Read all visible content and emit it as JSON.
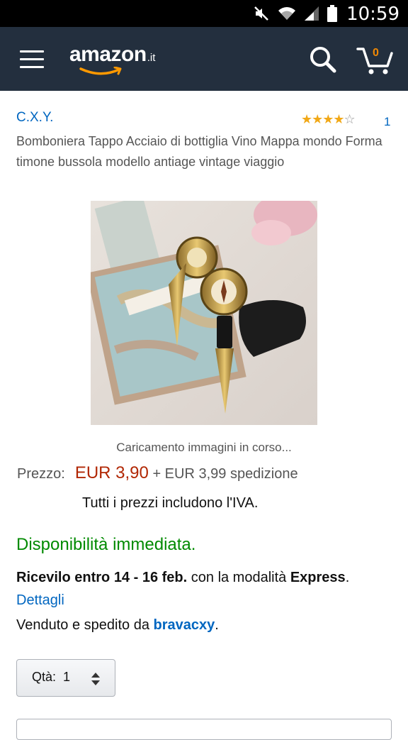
{
  "status_bar": {
    "time": "10:59",
    "icons": [
      "mute-icon",
      "wifi-icon",
      "signal-icon",
      "battery-icon"
    ]
  },
  "header": {
    "logo_word": "amazon",
    "logo_tld": ".it",
    "cart_count": "0",
    "bg_color": "#232f3e"
  },
  "product": {
    "brand": "C.X.Y.",
    "rating_value": 4,
    "rating_count": "1",
    "title": "Bomboniera Tappo Acciaio di bottiglia Vino Mappa mondo Forma timone bussola modello antiage vintage viaggio",
    "image_loading": "Caricamento immagini in corso...",
    "price_label": "Prezzo:",
    "price": "EUR 3,90",
    "shipping": "+ EUR 3,99 spedizione",
    "vat_note": "Tutti i prezzi includono l'IVA.",
    "availability": "Disponibilità immediata.",
    "delivery_prefix": "Ricevilo entro 14 - 16 feb.",
    "delivery_middle": " con la modalità ",
    "delivery_mode": "Express",
    "delivery_sep": ". ",
    "details_link": "Dettagli",
    "sold_prefix": "Venduto e spedito da ",
    "seller": "bravacxy",
    "sold_suffix": ".",
    "qty_label": "Qtà:",
    "qty_value": "1"
  },
  "colors": {
    "link": "#0066c0",
    "price": "#b12704",
    "available": "#008a00",
    "star": "#f1a817"
  }
}
